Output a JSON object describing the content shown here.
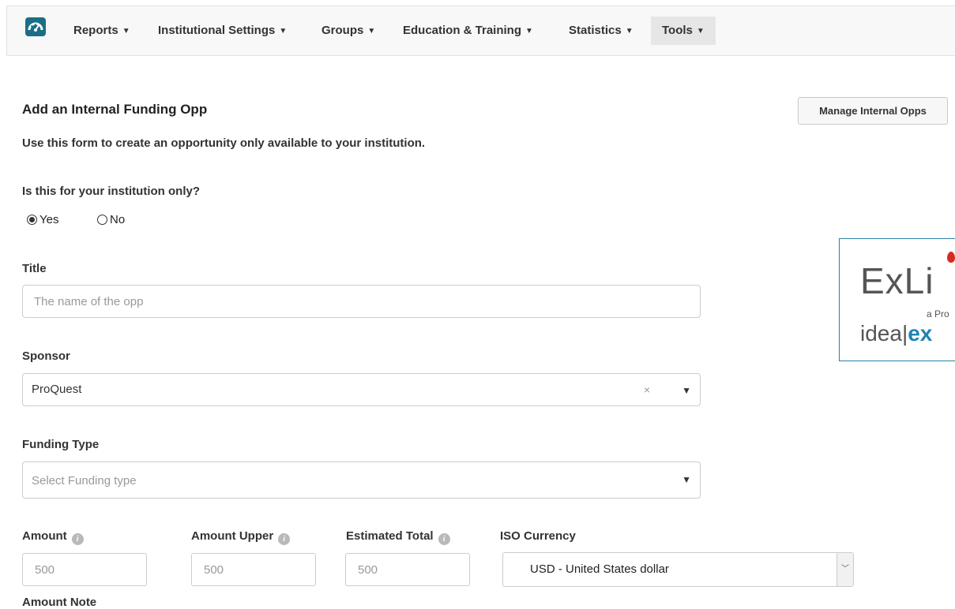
{
  "nav": {
    "logo_icon": "dashboard-gauge-icon",
    "items": [
      {
        "label": "Reports"
      },
      {
        "label": "Institutional Settings"
      },
      {
        "label": "Groups"
      },
      {
        "label": "Education & Training"
      },
      {
        "label": "Statistics"
      },
      {
        "label": "Tools",
        "active": true
      }
    ],
    "caret": "▼"
  },
  "page": {
    "heading": "Add an Internal Funding Opp",
    "manage_button": "Manage Internal Opps",
    "intro": "Use this form to create an opportunity only available to your institution."
  },
  "institution_only": {
    "question": "Is this for your institution only?",
    "options": [
      {
        "label": "Yes",
        "checked": true
      },
      {
        "label": "No",
        "checked": false
      }
    ]
  },
  "title": {
    "label": "Title",
    "placeholder": "The name of the opp",
    "value": ""
  },
  "sponsor": {
    "label": "Sponsor",
    "value": "ProQuest",
    "clear": "×",
    "arrow": "▼"
  },
  "funding_type": {
    "label": "Funding Type",
    "placeholder": "Select Funding type",
    "arrow": "▼"
  },
  "amounts": {
    "amount_label": "Amount",
    "amount_upper_label": "Amount Upper",
    "estimated_total_label": "Estimated Total",
    "currency_label": "ISO Currency",
    "info_icon": "i",
    "amount_placeholder": "500",
    "amount_upper_placeholder": "500",
    "estimated_total_placeholder": "500",
    "currency_value": "USD - United States dollar",
    "currency_arrow": "﹀"
  },
  "amount_note": {
    "label": "Amount Note"
  },
  "ad": {
    "brand": "ExLi",
    "sub": "a Pro",
    "tag_plain": "idea|",
    "tag_accent": "ex",
    "accent_color": "#1d84b5",
    "drop_color": "#d62c1f"
  },
  "colors": {
    "navbar_bg": "#f8f8f8",
    "logo_bg": "#1c6e86",
    "active_tab_bg": "#e6e6e6"
  }
}
